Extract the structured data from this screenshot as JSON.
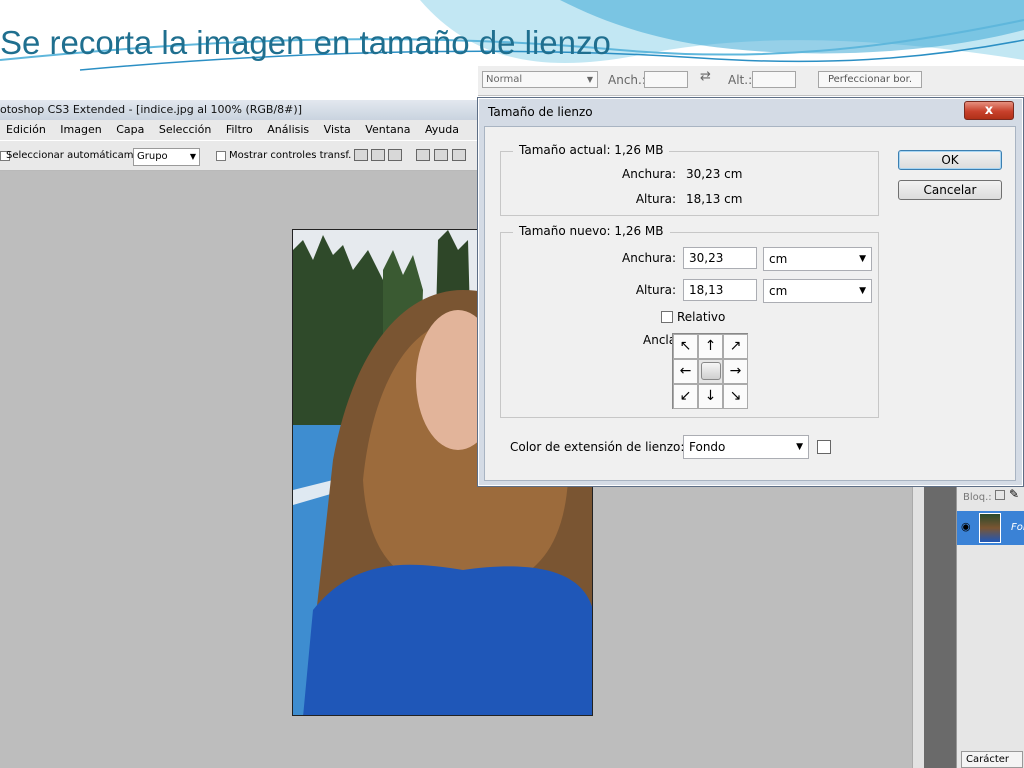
{
  "slide": {
    "title": "Se recorta la imagen en tamaño de lienzo"
  },
  "photoshop": {
    "window_title": "otoshop CS3 Extended - [indice.jpg al 100% (RGB/8#)]",
    "menu": [
      "Edición",
      "Imagen",
      "Capa",
      "Selección",
      "Filtro",
      "Análisis",
      "Vista",
      "Ventana",
      "Ayuda"
    ],
    "options": {
      "auto_select_label": "Seleccionar automáticamente:",
      "auto_select_value": "Grupo",
      "show_controls_label": "Mostrar controles transf."
    },
    "top_strip": {
      "mode_value": "Normal",
      "width_label": "Anch.:",
      "height_label": "Alt.:",
      "refine_button": "Perfeccionar bor."
    },
    "panel": {
      "lock_label": "Bloq.:",
      "layer_label": "Fon",
      "tab_label": "Carácter"
    }
  },
  "dialog": {
    "title": "Tamaño de lienzo",
    "close_label": "x",
    "ok_label": "OK",
    "cancel_label": "Cancelar",
    "current": {
      "title": "Tamaño actual: 1,26 MB",
      "width_label": "Anchura:",
      "width_value": "30,23 cm",
      "height_label": "Altura:",
      "height_value": "18,13 cm"
    },
    "new": {
      "title": "Tamaño nuevo: 1,26 MB",
      "width_label": "Anchura:",
      "width_value": "30,23",
      "width_unit": "cm",
      "height_label": "Altura:",
      "height_value": "18,13",
      "height_unit": "cm",
      "relative_label": "Relativo",
      "anchor_label": "Ancla:"
    },
    "extension": {
      "label": "Color de extensión de lienzo:",
      "value": "Fondo"
    }
  },
  "icons": {
    "close": "close-icon",
    "dropdown": "chevron-down-icon",
    "swap": "swap-icon",
    "eye": "eye-icon",
    "anchor_arrows": "arrow-icon"
  }
}
